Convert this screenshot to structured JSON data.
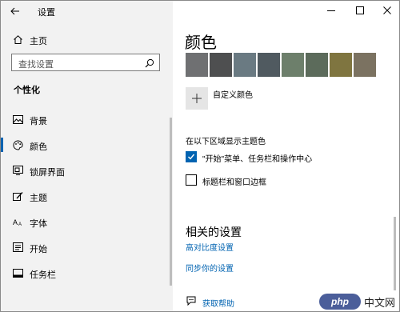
{
  "window": {
    "title": "设置",
    "controls": [
      "minimize",
      "maximize",
      "close"
    ]
  },
  "sidebar": {
    "home_label": "主页",
    "search_placeholder": "查找设置",
    "section_heading": "个性化",
    "items": [
      {
        "label": "背景",
        "icon": "picture-icon"
      },
      {
        "label": "颜色",
        "icon": "palette-icon",
        "selected": true
      },
      {
        "label": "锁屏界面",
        "icon": "lock-screen-icon"
      },
      {
        "label": "主题",
        "icon": "theme-brush-icon"
      },
      {
        "label": "字体",
        "icon": "font-icon"
      },
      {
        "label": "开始",
        "icon": "start-menu-icon"
      },
      {
        "label": "任务栏",
        "icon": "taskbar-icon"
      }
    ]
  },
  "main": {
    "page_title": "颜色",
    "swatches": [
      "#6f7072",
      "#4e4f50",
      "#6a7a82",
      "#505a60",
      "#6d7f6b",
      "#5c6b5b",
      "#7f7540",
      "#7b7261"
    ],
    "custom_color_label": "自定义颜色",
    "accent_surfaces_heading": "在以下区域显示主题色",
    "options": [
      {
        "label": "\"开始\"菜单、任务栏和操作中心",
        "checked": true
      },
      {
        "label": "标题栏和窗口边框",
        "checked": false
      }
    ],
    "related_settings_title": "相关的设置",
    "related_links": [
      "高对比度设置",
      "同步你的设置"
    ],
    "help_label": "获取帮助"
  },
  "colors": {
    "accent": "#0063b1",
    "sidebar_bg": "#f2f2f2"
  },
  "watermark": {
    "logo_text": "php",
    "site_text": "中文网"
  }
}
